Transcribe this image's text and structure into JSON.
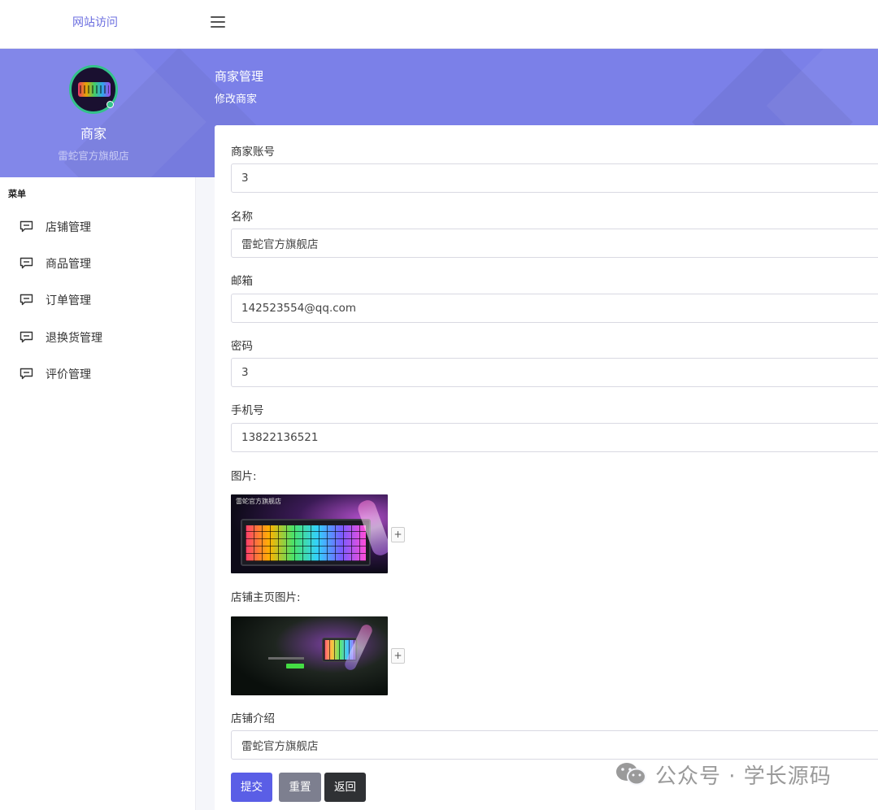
{
  "topbar": {
    "site_link": "网站访问"
  },
  "profile": {
    "role": "商家",
    "shop_name": "雷蛇官方旗舰店"
  },
  "page_header": {
    "title": "商家管理",
    "subtitle": "修改商家"
  },
  "sidebar": {
    "menu_title": "菜单",
    "items": [
      {
        "label": "店铺管理",
        "icon": "message-icon"
      },
      {
        "label": "商品管理",
        "icon": "message-icon"
      },
      {
        "label": "订单管理",
        "icon": "message-icon"
      },
      {
        "label": "退换货管理",
        "icon": "message-icon"
      },
      {
        "label": "评价管理",
        "icon": "message-icon"
      }
    ]
  },
  "form": {
    "account": {
      "label": "商家账号",
      "value": "3"
    },
    "name": {
      "label": "名称",
      "value": "雷蛇官方旗舰店"
    },
    "email": {
      "label": "邮箱",
      "value": "142523554@qq.com"
    },
    "password": {
      "label": "密码",
      "value": "3"
    },
    "phone": {
      "label": "手机号",
      "value": "13822136521"
    },
    "image": {
      "label": "图片:",
      "add_label": "+",
      "brand_text": "雷蛇官方旗舰店"
    },
    "home_image": {
      "label": "店铺主页图片:",
      "add_label": "+"
    },
    "intro": {
      "label": "店铺介绍",
      "value": "雷蛇官方旗舰店"
    },
    "buttons": {
      "submit": "提交",
      "reset": "重置",
      "back": "返回"
    }
  },
  "watermark": {
    "text": "公众号 · 学长源码"
  },
  "colors": {
    "accent": "#5a5ee6",
    "banner": "#7b80e8",
    "online": "#33c28a"
  }
}
